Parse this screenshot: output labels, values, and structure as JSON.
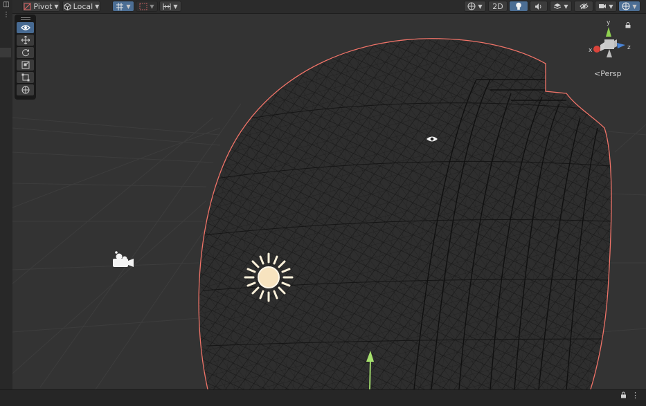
{
  "toolbar": {
    "pivot_label": "Pivot",
    "local_label": "Local",
    "twod_label": "2D",
    "icons": [
      "pivot-icon",
      "local-icon",
      "grid-snap-icon",
      "increment-snap-icon",
      "align-icon",
      "shading-mode-icon",
      "lighting-icon",
      "audio-icon",
      "effects-icon",
      "scene-visibility-icon",
      "camera-icon",
      "gizmos-icon"
    ]
  },
  "tools": [
    "view-tool",
    "move-tool",
    "rotate-tool",
    "scale-tool",
    "rect-tool",
    "transform-tool"
  ],
  "gizmo": {
    "y_label": "y",
    "x_label": "x",
    "z_label": "z",
    "projection_label": "<Persp",
    "colors": {
      "x": "#d9443b",
      "y": "#8fd14f",
      "z": "#4a84d6"
    }
  },
  "scene": {
    "selection_outline_color": "#f07368",
    "icons": [
      "camera-gizmo-icon",
      "light-gizmo-icon",
      "visibility-icon",
      "y-axis-handle-icon"
    ]
  }
}
